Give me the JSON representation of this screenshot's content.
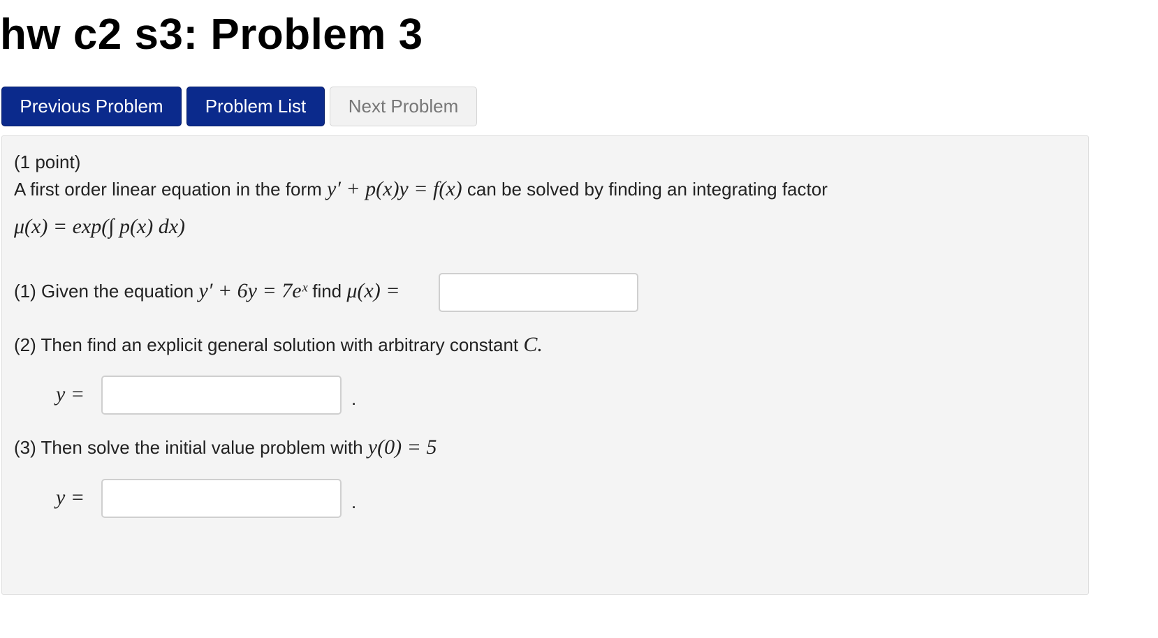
{
  "page": {
    "title": "hw c2 s3: Problem 3"
  },
  "nav": {
    "previous_label": "Previous Problem",
    "list_label": "Problem List",
    "next_label": "Next Problem"
  },
  "problem": {
    "points": "(1 point)",
    "intro_text_1": "A first order linear equation in the form",
    "intro_eq": "y′ + p(x)y = f(x)",
    "intro_text_2": "can be solved by finding an integrating factor",
    "mu_def": "μ(x) = exp(∫ p(x) dx)",
    "part1_text": "(1) Given the equation",
    "part1_eq": "y′ + 6y = 7eˣ",
    "part1_find": "find",
    "part1_mu": "μ(x) =",
    "part1_value": "",
    "part2_text": "(2) Then find an explicit general solution with arbitrary constant",
    "part2_const": "C.",
    "part2_label": "y =",
    "part2_value": "",
    "part3_text": "(3) Then solve the initial value problem with",
    "part3_eq": "y(0) = 5",
    "part3_label": "y =",
    "part3_value": "",
    "period": "."
  }
}
